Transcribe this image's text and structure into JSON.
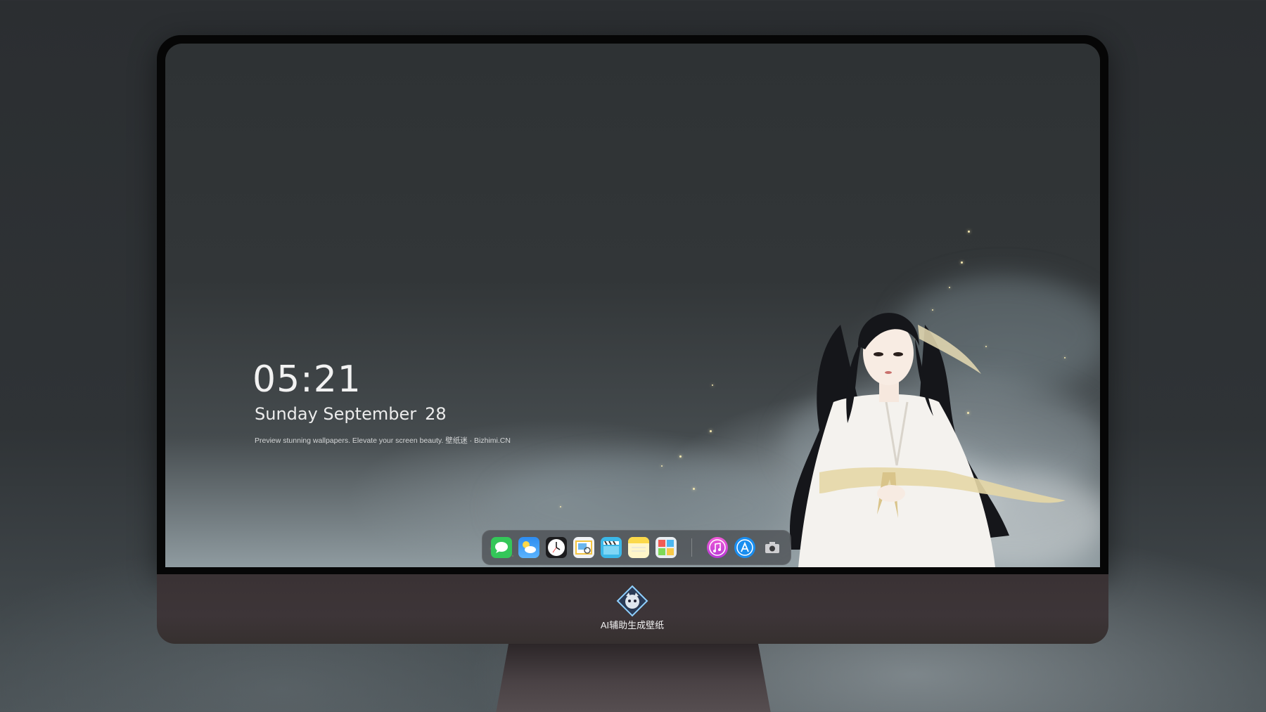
{
  "lockscreen": {
    "time": "05:21",
    "weekday_month": "Sunday September",
    "day": "28",
    "tagline": "Preview stunning wallpapers. Elevate your screen beauty. 壁纸迷 · Bizhimi.CN"
  },
  "dock": {
    "apps": [
      {
        "name": "messages-icon",
        "color": "#34c759"
      },
      {
        "name": "weather-icon",
        "color": "#2d8cf0"
      },
      {
        "name": "clock-icon",
        "color": "#1c1c1e"
      },
      {
        "name": "preview-icon",
        "color": "#f4c542"
      },
      {
        "name": "clips-icon",
        "color": "#3bb8e8"
      },
      {
        "name": "notes-icon",
        "color": "#fbd94a"
      },
      {
        "name": "photo-booth-icon",
        "color": "#e9eef2"
      },
      {
        "name": "music-icon",
        "color": "#d642c8"
      },
      {
        "name": "app-store-icon",
        "color": "#1a8ef0"
      },
      {
        "name": "camera-icon",
        "color": "#6f6f72"
      }
    ]
  },
  "monitor": {
    "brand_text": "AI辅助生成壁纸"
  }
}
